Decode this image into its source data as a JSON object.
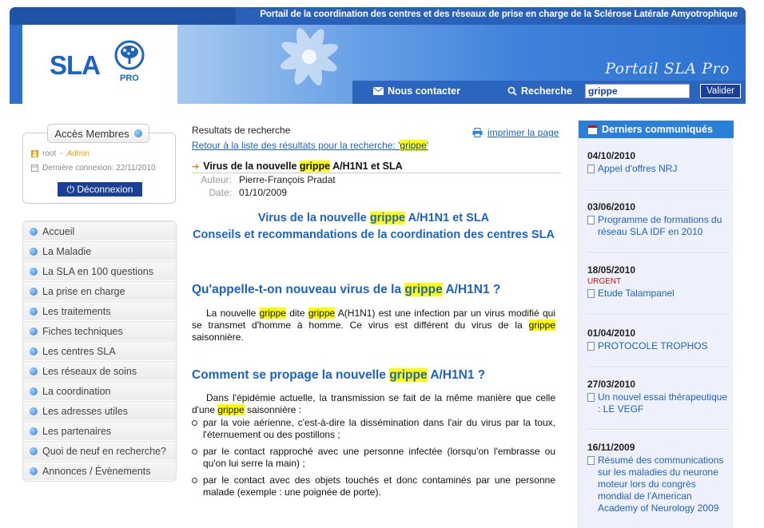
{
  "header": {
    "tagline": "Portail de la coordination des centres et des réseaux de prise en charge de la Sclérose Latérale Amyotrophique",
    "logo_main": "SLA",
    "logo_sub": "PRO",
    "portal_title": "Portail SLA Pro",
    "contact_label": "Nous contacter",
    "search_label": "Recherche",
    "search_value": "grippe",
    "submit_label": "Valider"
  },
  "members": {
    "title": "Accès Membres",
    "user": "root",
    "role": "Admin",
    "last_login": "Dernière connexion: 22/11/2010",
    "logout_label": "Déconnexion"
  },
  "nav": {
    "items": [
      "Accueil",
      "La Maladie",
      "La SLA en 100 questions",
      "La prise en charge",
      "Les traitements",
      "Fiches techniques",
      "Les centres SLA",
      "Les réseaux de soins",
      "La coordination",
      "Les adresses utiles",
      "Les partenaires",
      "Quoi de neuf en recherche?",
      "Annonces / Évènements"
    ]
  },
  "main": {
    "results_title": "Resultats de recherche",
    "print_label": "imprimer la page",
    "back_prefix": "Retour à la liste des résultats pour la recherche: '",
    "back_term": "grippe",
    "back_suffix": "'",
    "article_head_pre": "Virus de la nouvelle",
    "article_head_term": "grippe",
    "article_head_post": "A/H1N1 et SLA",
    "author_key": "Auteur:",
    "author_val": "Pierre-François Pradat",
    "date_key": "Date:",
    "date_val": "01/10/2009",
    "title_l1_pre": "Virus de la nouvelle",
    "title_l1_term": "grippe",
    "title_l1_post": "A/H1N1 et SLA",
    "title_l2": "Conseils et recommandations de la coordination des centres SLA",
    "h1_pre": "Qu'appelle-t-on nouveau virus de la",
    "h1_term": "grippe",
    "h1_post": "A/H1N1 ?",
    "p1_a": "La nouvelle",
    "p1_b": "dite",
    "p1_c": "A(H1N1) est une infection par un virus modifié qui se transmet d'homme à homme. Ce virus est différent du virus de la",
    "p1_d": "saisonnière.",
    "term": "grippe",
    "h2_pre": "Comment se propage la nouvelle",
    "h2_term": "grippe",
    "h2_post": "A/H1N1 ?",
    "p2_a": "Dans l'épidémie actuelle, la transmission se fait de la même manière que celle d'une",
    "p2_b": "saisonnière :",
    "bullets": [
      "par la voie aérienne, c'est-à-dire la dissémination dans l'air du virus par la toux, l'éternuement ou des postillons ;",
      "par le contact rapproché avec une personne infectée (lorsqu'on l'embrasse ou qu'on lui serre la main) ;",
      "par le contact avec des objets touchés et donc contaminés par une personne malade (exemple : une poignée de porte)."
    ]
  },
  "news": {
    "title": "Derniers communiqués",
    "items": [
      {
        "date": "04/10/2010",
        "urgent": "",
        "text": "Appel d'offres NRJ"
      },
      {
        "date": "03/06/2010",
        "urgent": "",
        "text": "Programme de formations du réseau SLA IDF en 2010"
      },
      {
        "date": "18/05/2010",
        "urgent": "URGENT",
        "text": "Etude Talampanel"
      },
      {
        "date": "01/04/2010",
        "urgent": "",
        "text": "PROTOCOLE TROPHOS"
      },
      {
        "date": "27/03/2010",
        "urgent": "",
        "text": "Un nouvel essai thérapeutique : LE VEGF"
      },
      {
        "date": "16/11/2009",
        "urgent": "",
        "text": "Résumé des communications sur les maladies du neurone moteur lors du congrès mondial de l'American Academy of Neurology 2009"
      }
    ]
  },
  "colors": {
    "brand_blue": "#1d63c4",
    "highlight": "#ffff00",
    "urgent": "#d01010"
  }
}
